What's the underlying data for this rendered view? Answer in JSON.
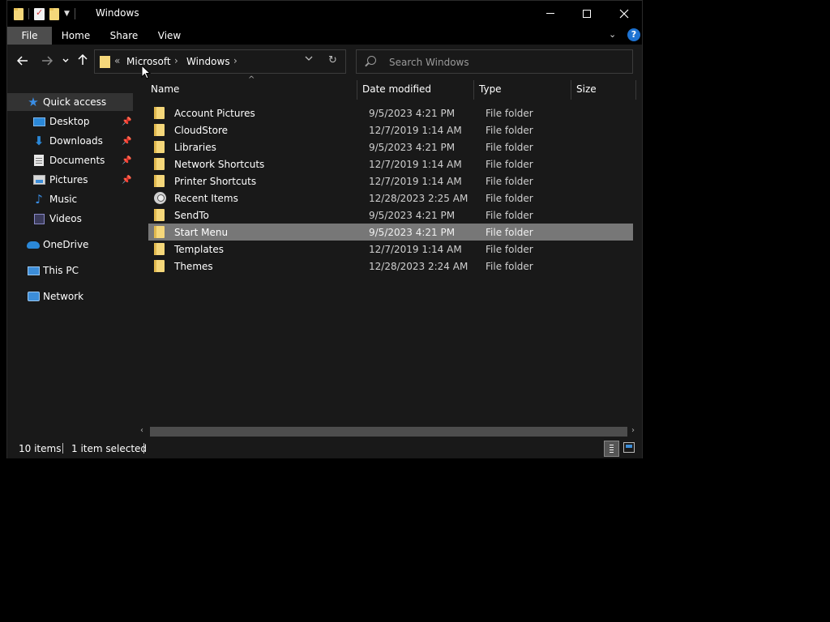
{
  "window": {
    "title": "Windows",
    "controls": {
      "minimize": "minimize",
      "maximize": "maximize",
      "close": "close"
    }
  },
  "ribbon": {
    "tabs": [
      {
        "label": "File"
      },
      {
        "label": "Home"
      },
      {
        "label": "Share"
      },
      {
        "label": "View"
      }
    ],
    "help": "?"
  },
  "address": {
    "overflow": "«",
    "crumbs": [
      {
        "label": "Microsoft"
      },
      {
        "label": "Windows"
      }
    ]
  },
  "search": {
    "placeholder": "Search Windows"
  },
  "navpane": {
    "items": [
      {
        "label": "Quick access",
        "icon": "star-icon",
        "selected": true
      },
      {
        "label": "Desktop",
        "icon": "desktop-icon",
        "pinned": true
      },
      {
        "label": "Downloads",
        "icon": "downloads-icon",
        "pinned": true
      },
      {
        "label": "Documents",
        "icon": "documents-icon",
        "pinned": true
      },
      {
        "label": "Pictures",
        "icon": "pictures-icon",
        "pinned": true
      },
      {
        "label": "Music",
        "icon": "music-icon"
      },
      {
        "label": "Videos",
        "icon": "videos-icon"
      },
      {
        "label": "OneDrive",
        "icon": "onedrive-icon"
      },
      {
        "label": "This PC",
        "icon": "this-pc-icon"
      },
      {
        "label": "Network",
        "icon": "network-icon"
      }
    ]
  },
  "columns": {
    "name": "Name",
    "date": "Date modified",
    "type": "Type",
    "size": "Size"
  },
  "files": [
    {
      "name": "Account Pictures",
      "date": "9/5/2023 4:21 PM",
      "type": "File folder"
    },
    {
      "name": "CloudStore",
      "date": "12/7/2019 1:14 AM",
      "type": "File folder"
    },
    {
      "name": "Libraries",
      "date": "9/5/2023 4:21 PM",
      "type": "File folder"
    },
    {
      "name": "Network Shortcuts",
      "date": "12/7/2019 1:14 AM",
      "type": "File folder"
    },
    {
      "name": "Printer Shortcuts",
      "date": "12/7/2019 1:14 AM",
      "type": "File folder"
    },
    {
      "name": "Recent Items",
      "date": "12/28/2023 2:25 AM",
      "type": "File folder",
      "special": true
    },
    {
      "name": "SendTo",
      "date": "9/5/2023 4:21 PM",
      "type": "File folder"
    },
    {
      "name": "Start Menu",
      "date": "9/5/2023 4:21 PM",
      "type": "File folder",
      "selected": true
    },
    {
      "name": "Templates",
      "date": "12/7/2019 1:14 AM",
      "type": "File folder"
    },
    {
      "name": "Themes",
      "date": "12/28/2023 2:24 AM",
      "type": "File folder"
    }
  ],
  "status": {
    "count": "10 items",
    "selection": "1 item selected"
  },
  "colors": {
    "accent": "#2b88d8",
    "folder": "#f5d77a",
    "selection": "#777777"
  }
}
